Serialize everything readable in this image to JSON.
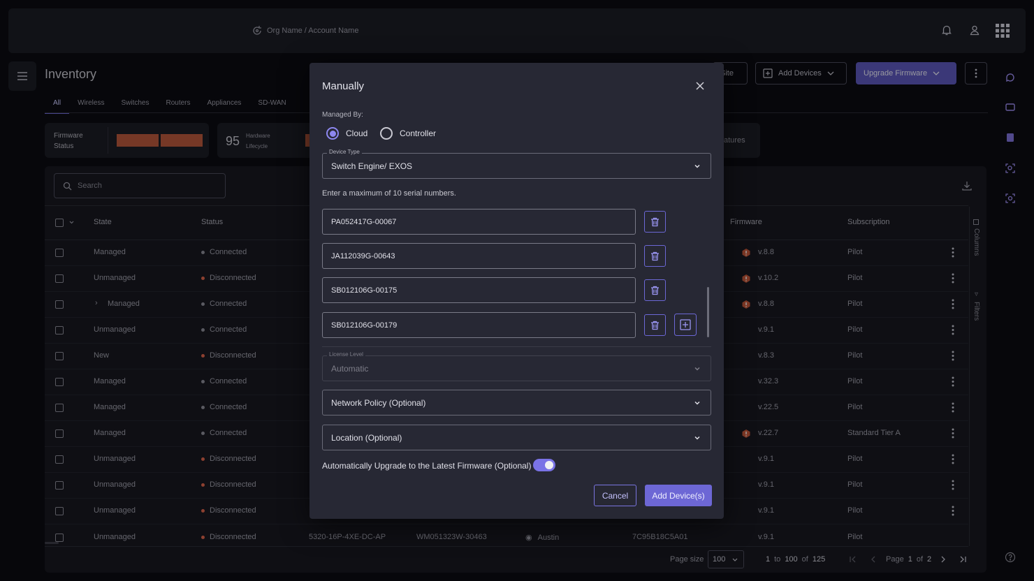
{
  "header": {
    "org_label": "Org Name / Account Name"
  },
  "page": {
    "title": "Inventory",
    "tabs": [
      "All",
      "Wireless",
      "Switches",
      "Routers",
      "Appliances",
      "SD-WAN"
    ],
    "buttons": {
      "site": "Site",
      "add_devices": "Add Devices",
      "upgrade_firmware": "Upgrade Firmware"
    },
    "summary": {
      "firmware_label_1": "Firmware",
      "firmware_label_2": "Status",
      "hw_count": "95",
      "hw_label_1": "Hardware",
      "hw_label_2": "Lifecycle",
      "features_partial": "atures"
    },
    "search_placeholder": "Search",
    "columns": {
      "state": "State",
      "status": "Status",
      "firmware": "Firmware",
      "subscription": "Subscription"
    },
    "side_labels": {
      "columns": "Columns",
      "filters": "Filters"
    }
  },
  "rows": [
    {
      "state": "Managed",
      "status": "Connected",
      "firmware": "v.8.8",
      "subscription": "Pilot",
      "warn": true,
      "expand": false
    },
    {
      "state": "Unmanaged",
      "status": "Disconnected",
      "firmware": "v.10.2",
      "subscription": "Pilot",
      "warn": true,
      "expand": false
    },
    {
      "state": "Managed",
      "status": "Connected",
      "firmware": "v.8.8",
      "subscription": "Pilot",
      "warn": true,
      "expand": true
    },
    {
      "state": "Unmanaged",
      "status": "Connected",
      "firmware": "v.9.1",
      "subscription": "Pilot",
      "warn": false,
      "expand": false
    },
    {
      "state": "New",
      "status": "Disconnected",
      "firmware": "v.8.3",
      "subscription": "Pilot",
      "warn": false,
      "expand": false
    },
    {
      "state": "Managed",
      "status": "Connected",
      "firmware": "v.32.3",
      "subscription": "Pilot",
      "warn": false,
      "expand": false
    },
    {
      "state": "Managed",
      "status": "Connected",
      "firmware": "v.22.5",
      "subscription": "Pilot",
      "warn": false,
      "expand": false
    },
    {
      "state": "Managed",
      "status": "Connected",
      "firmware": "v.22.7",
      "subscription": "Standard Tier A",
      "warn": true,
      "expand": false
    },
    {
      "state": "Unmanaged",
      "status": "Disconnected",
      "firmware": "v.9.1",
      "subscription": "Pilot",
      "warn": false,
      "expand": false
    },
    {
      "state": "Unmanaged",
      "status": "Disconnected",
      "firmware": "v.9.1",
      "subscription": "Pilot",
      "warn": false,
      "expand": false
    },
    {
      "state": "Unmanaged",
      "status": "Disconnected",
      "firmware": "v.9.1",
      "subscription": "Pilot",
      "warn": false,
      "expand": false
    }
  ],
  "partial_row": {
    "state": "Unmanaged",
    "status": "Disconnected",
    "model": "5320-16P-4XE-DC-AP",
    "serial": "WM051323W-30463",
    "location": "Austin",
    "mac": "7C95B18C5A01",
    "firmware": "v.9.1",
    "subscription": "Pilot"
  },
  "footer": {
    "page_size_label": "Page size",
    "page_size": "100",
    "range_from": "1",
    "to": "to",
    "range_to": "100",
    "of": "of",
    "total": "125",
    "page_label": "Page",
    "page": "1",
    "of2": "of",
    "pages": "2"
  },
  "modal": {
    "title": "Manually",
    "managed_by_label": "Managed By:",
    "option_cloud": "Cloud",
    "option_controller": "Controller",
    "device_type_label": "Device Type",
    "device_type_value": "Switch Engine/ EXOS",
    "serial_hint": "Enter a maximum of 10 serial numbers.",
    "serials": [
      "PA052417G-00067",
      "JA112039G-00643",
      "SB012106G-00175",
      "SB012106G-00179"
    ],
    "license_label": "License Level",
    "license_value": "Automatic",
    "network_policy": "Network Policy (Optional)",
    "location": "Location (Optional)",
    "auto_upgrade_label": "Automatically Upgrade to the Latest Firmware (Optional)",
    "auto_upgrade_on": true,
    "cancel": "Cancel",
    "add": "Add Device(s)"
  },
  "colors": {
    "accent": "#6d67d5",
    "warn": "#c2573a",
    "connected": "#8a8a96",
    "disconnected": "#d9634a"
  }
}
